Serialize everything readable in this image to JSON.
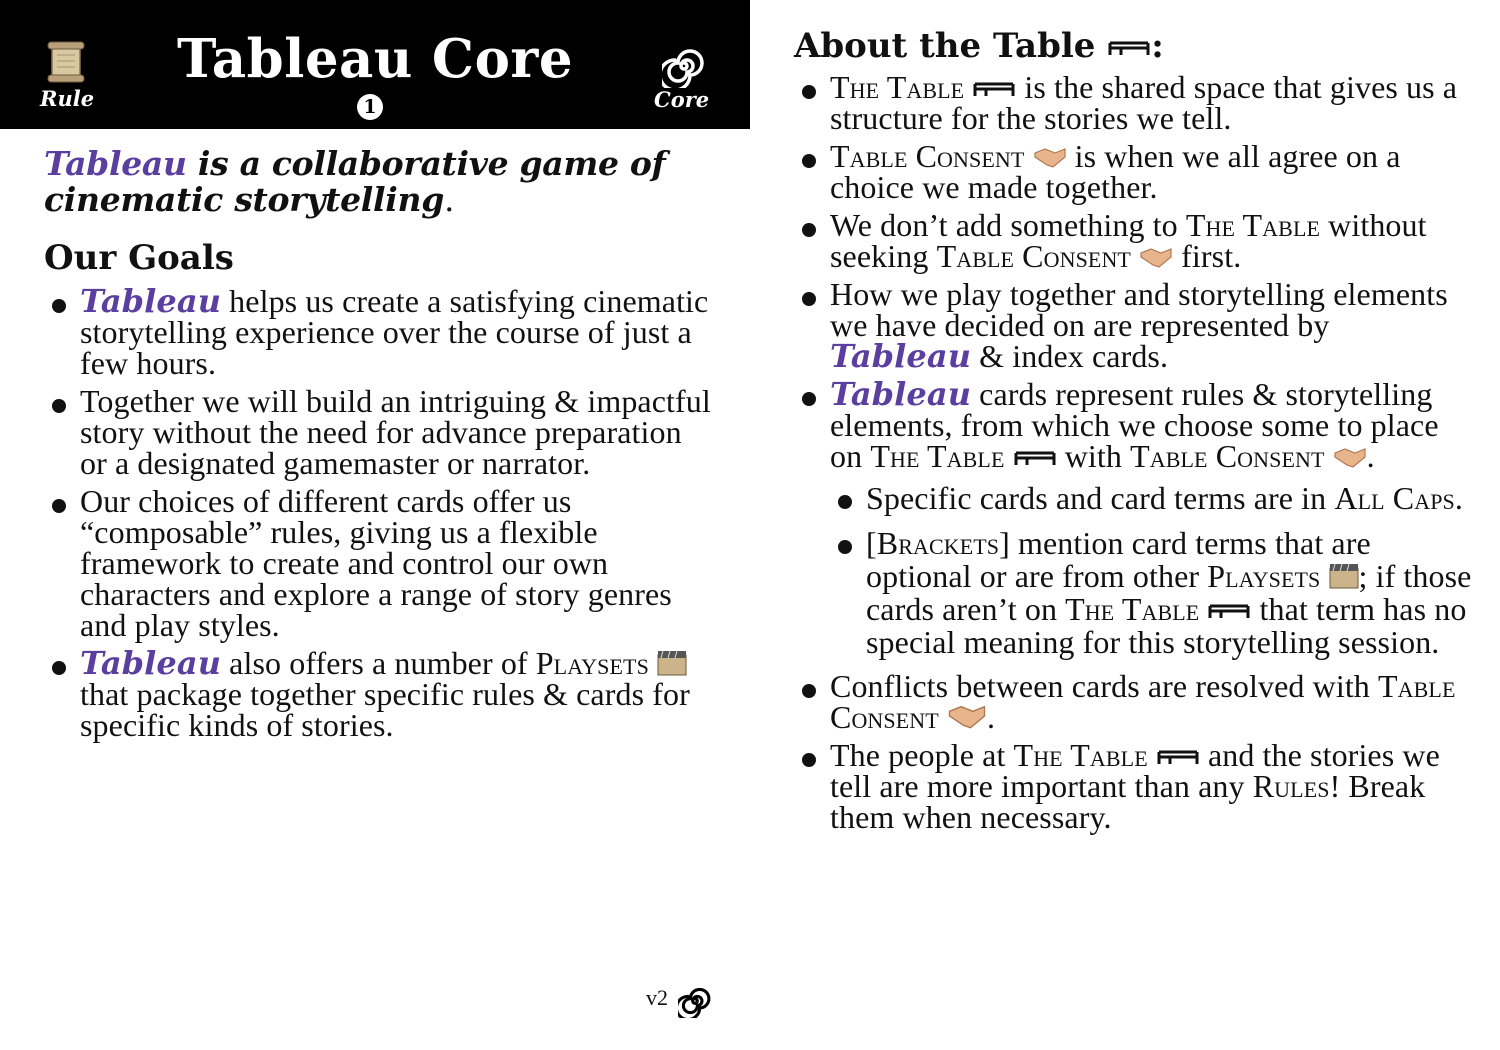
{
  "header": {
    "title": "Tableau Core",
    "number": "1",
    "left_label": "Rule",
    "right_label": "Core",
    "left_icon": "scroll-icon",
    "right_icon": "spiral-icon"
  },
  "left": {
    "intro_brand": "Tableau",
    "intro_rest": " is a collaborative game of cinematic storytelling",
    "intro_end": ".",
    "goals_heading": "Our Goals",
    "b1_brand": "Tableau",
    "b1_rest": " helps us create a satisfying cinematic storytelling experience over the course of just a few hours.",
    "b2": "Together we will build an intriguing & impactful story without the need for advance preparation or a designated gamemaster or narrator.",
    "b3": "Our choices of different cards offer us “composable” rules, giving us a flexible framework to create and control our own characters and explore a range of story genres and play styles.",
    "b4_brand": "Tableau",
    "b4_a": " also offers a number of ",
    "b4_playsets": "Playsets",
    "b4_b": " that package together specific rules & cards for specific kinds of stories."
  },
  "right": {
    "heading": "About the Table",
    "heading_colon": ":",
    "r1_term": "The Table",
    "r1_rest": " is the shared space that gives us a structure for the stories we tell.",
    "r2_term": "Table Consent",
    "r2_rest": " is when we all agree on a choice we made together.",
    "r3_a": "We don’t add something to ",
    "r3_term1": "The Table",
    "r3_b": " without seeking ",
    "r3_term2": "Table Consent",
    "r3_c": " first.",
    "r4_a": "How we play together and storytelling elements we have decided on are represented by ",
    "r4_brand": "Tableau",
    "r4_b": " & index cards.",
    "r5_brand": "Tableau",
    "r5_a": " cards represent rules & storytelling elements, from which we choose some to place on ",
    "r5_term1": "The Table",
    "r5_b": " with ",
    "r5_term2": "Table Consent",
    "r5_c": ".",
    "s1_a": "Specific cards and card terms are in ",
    "s1_term": "All Caps",
    "s1_b": ".",
    "s2_a": "[",
    "s2_term1": "Brackets",
    "s2_b": "] mention card terms that are optional or are from other ",
    "s2_term2": "Playsets",
    "s2_c": "; if those cards aren’t on ",
    "s2_term3": "The Table",
    "s2_d": " that term has no special meaning for this storytelling session.",
    "r6_a": "Conflicts between cards are resolved with ",
    "r6_term": "Table Consent",
    "r6_b": ".",
    "r7_a": "The people at ",
    "r7_term1": "The Table",
    "r7_b": " and the stories we tell are more important than any ",
    "r7_term2": "Rules",
    "r7_c": "! Break them when necessary."
  },
  "footer": {
    "version": "v2",
    "icon": "spiral-icon"
  },
  "colors": {
    "brand": "#5b3fa0",
    "header_bg": "#000000"
  }
}
